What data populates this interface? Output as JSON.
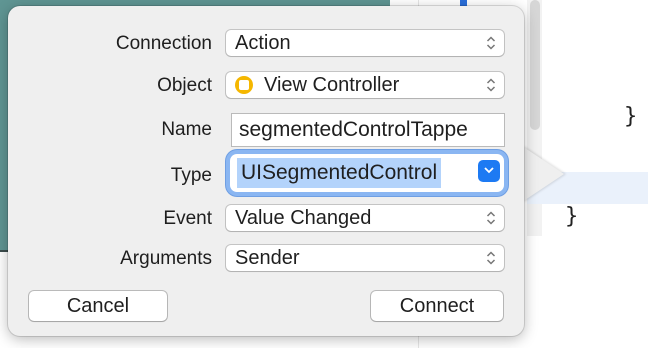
{
  "editor": {
    "brace_upper": "}",
    "brace_lower": "}"
  },
  "dialog": {
    "connection": {
      "label": "Connection",
      "value": "Action"
    },
    "object": {
      "label": "Object",
      "value": "View Controller",
      "icon": "view-controller-icon"
    },
    "name": {
      "label": "Name",
      "value": "segmentedControlTappe"
    },
    "type": {
      "label": "Type",
      "value": "UISegmentedControl"
    },
    "event": {
      "label": "Event",
      "value": "Value Changed"
    },
    "arguments": {
      "label": "Arguments",
      "value": "Sender"
    },
    "buttons": {
      "cancel": "Cancel",
      "connect": "Connect"
    },
    "colors": {
      "accent": "#1d7af3",
      "selection": "#b3d3fb",
      "focus_ring": "#8ab6f2"
    }
  }
}
